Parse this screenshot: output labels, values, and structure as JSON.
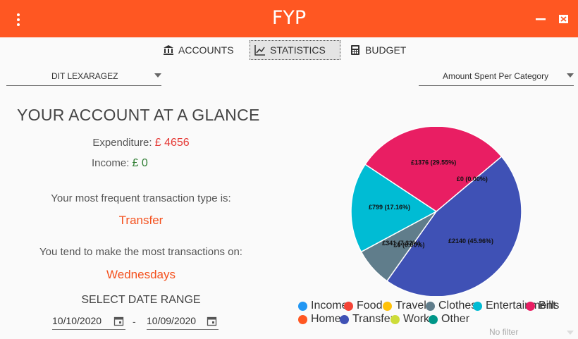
{
  "app": {
    "title": "FYP"
  },
  "tabs": [
    {
      "label": "ACCOUNTS",
      "icon": "bank-icon"
    },
    {
      "label": "STATISTICS",
      "icon": "line-chart-icon",
      "active": true
    },
    {
      "label": "BUDGET",
      "icon": "calculator-icon"
    }
  ],
  "account_select": {
    "value": "DIT LEXARAGEZ"
  },
  "chart_select": {
    "value": "Amount Spent Per Category"
  },
  "summary": {
    "heading": "YOUR ACCOUNT AT A GLANCE",
    "expenditure_label": "Expenditure:",
    "expenditure_value": "£ 4656",
    "income_label": "Income:",
    "income_value": "£ 0",
    "frequent_type_label": "Your most frequent transaction type is:",
    "frequent_type_value": "Transfer",
    "frequent_day_label": "You tend to make the most transactions on:",
    "frequent_day_value": "Wednesdays"
  },
  "date_range": {
    "label": "SELECT DATE RANGE",
    "from": "10/10/2020",
    "separator": "-",
    "to": "10/09/2020"
  },
  "filter": {
    "value": "No filter"
  },
  "colors": {
    "titlebar": "#ff5722",
    "expenditure": "#e53935",
    "income": "#2e7d32",
    "accent": "#f4511e"
  },
  "chart_data": {
    "type": "pie",
    "legend_position": "bottom",
    "categories": [
      {
        "name": "Income",
        "color": "#2196f3"
      },
      {
        "name": "Food",
        "color": "#f44336"
      },
      {
        "name": "Travel",
        "color": "#ffc107"
      },
      {
        "name": "Clothes",
        "color": "#607d8b"
      },
      {
        "name": "Entertainment",
        "color": "#00bcd4"
      },
      {
        "name": "Bills",
        "color": "#e91e63"
      },
      {
        "name": "Home",
        "color": "#ff5722"
      },
      {
        "name": "Transfer",
        "color": "#3f51b5"
      },
      {
        "name": "Work",
        "color": "#cddc39"
      },
      {
        "name": "Other",
        "color": "#009688"
      }
    ],
    "slices": [
      {
        "category": "Transfer",
        "value": 2140,
        "label": "£2140 (45.96%)",
        "color": "#3f51b5"
      },
      {
        "category": "Clothes",
        "value": 0,
        "label": "£0 (0.00%)",
        "color": "#607d8b"
      },
      {
        "category": "Clothes",
        "value": 341,
        "label": "£341 (7.32%)",
        "color": "#607d8b"
      },
      {
        "category": "Entertainment",
        "value": 799,
        "label": "£799 (17.16%)",
        "color": "#00bcd4"
      },
      {
        "category": "Bills",
        "value": 1376,
        "label": "£1376 (29.55%)",
        "color": "#e91e63"
      },
      {
        "category": "Food",
        "value": 0,
        "label": "£0 (0.00%)",
        "color": "#f44336"
      }
    ]
  }
}
